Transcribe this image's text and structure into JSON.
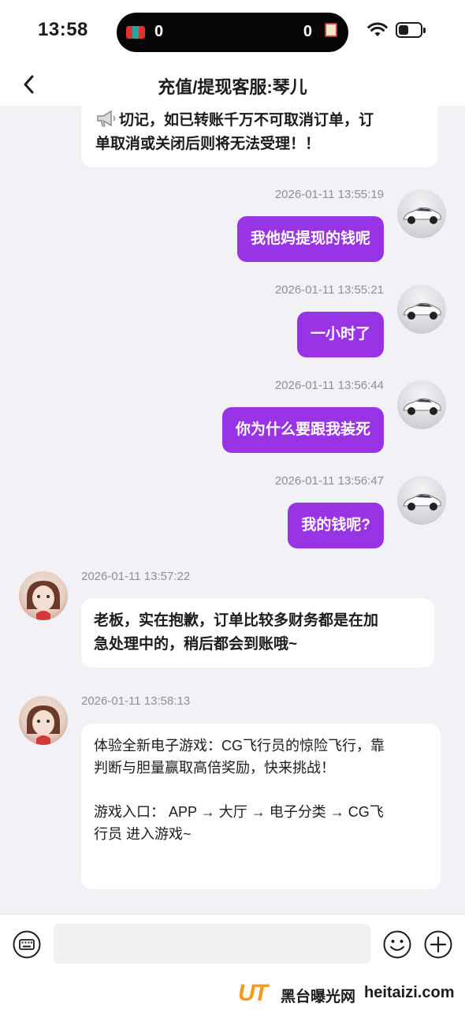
{
  "status_bar": {
    "time": "13:58",
    "island_left_count": "0",
    "island_right_count": "0"
  },
  "nav": {
    "title": "充值/提现客服:琴儿"
  },
  "messages": [
    {
      "side": "left",
      "text_line1": "切记，如已转账千万不可取消订单，订",
      "text_line2": "单取消或关闭后则将无法受理！！"
    },
    {
      "side": "right",
      "time": "2026-01-11 13:55:19",
      "text": "我他妈提现的钱呢"
    },
    {
      "side": "right",
      "time": "2026-01-11 13:55:21",
      "text": "一小时了"
    },
    {
      "side": "right",
      "time": "2026-01-11 13:56:44",
      "text": "你为什么要跟我装死"
    },
    {
      "side": "right",
      "time": "2026-01-11 13:56:47",
      "text": "我的钱呢?"
    },
    {
      "side": "left",
      "time": "2026-01-11 13:57:22",
      "text_line1": "老板，实在抱歉，订单比较多财务都是在加",
      "text_line2": "急处理中的，稍后都会到账哦~"
    },
    {
      "side": "left",
      "time": "2026-01-11 13:58:13",
      "text_line1": "体验全新电子游戏：CG飞行员的惊险飞行，靠",
      "text_line2": "判断与胆量赢取高倍奖励，快来挑战！",
      "text_line3": "游戏入口： APP → 大厅 → 电子分类 → CG飞",
      "text_line4": "行员 进入游戏~"
    }
  ],
  "input": {
    "placeholder": ""
  },
  "watermark": {
    "logo": "UT",
    "site_cn": "黑台曝光网",
    "site_en": "heitaizi.com"
  },
  "colors": {
    "accent_purple": "#9933e6",
    "chat_background": "#f1f1f6",
    "watermark_orange": "#f39a1f"
  }
}
